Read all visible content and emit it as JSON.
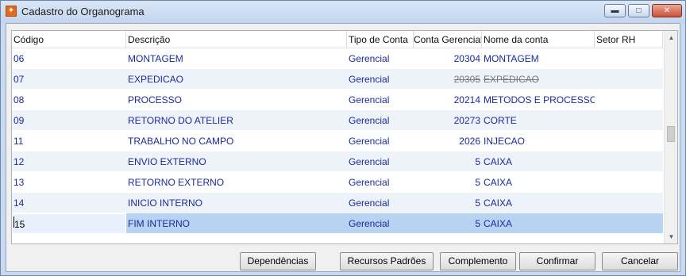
{
  "window": {
    "title": "Cadastro do Organograma",
    "controls": {
      "minimize": "▬",
      "maximize": "□",
      "close": "✕"
    }
  },
  "grid": {
    "columns": [
      "Código",
      "Descrição",
      "Tipo de Conta",
      "Conta Gerencial",
      "Nome da conta",
      "Setor RH"
    ],
    "rows": [
      {
        "codigo": "06",
        "descricao": "MONTAGEM",
        "tipo": "Gerencial",
        "conta": "20304",
        "nome": "MONTAGEM",
        "setor": ""
      },
      {
        "codigo": "07",
        "descricao": "EXPEDICAO",
        "tipo": "Gerencial",
        "conta": "20305",
        "nome": "EXPEDICAO",
        "setor": ""
      },
      {
        "codigo": "08",
        "descricao": "PROCESSO",
        "tipo": "Gerencial",
        "conta": "20214",
        "nome": "METODOS E PROCESSOS",
        "setor": ""
      },
      {
        "codigo": "09",
        "descricao": "RETORNO DO ATELIER",
        "tipo": "Gerencial",
        "conta": "20273",
        "nome": "CORTE",
        "setor": ""
      },
      {
        "codigo": "11",
        "descricao": "TRABALHO NO CAMPO",
        "tipo": "Gerencial",
        "conta": "2026",
        "nome": "INJECAO",
        "setor": ""
      },
      {
        "codigo": "12",
        "descricao": "ENVIO EXTERNO",
        "tipo": "Gerencial",
        "conta": "5",
        "nome": "CAIXA",
        "setor": ""
      },
      {
        "codigo": "13",
        "descricao": "RETORNO EXTERNO",
        "tipo": "Gerencial",
        "conta": "5",
        "nome": "CAIXA",
        "setor": ""
      },
      {
        "codigo": "14",
        "descricao": "INICIO INTERNO",
        "tipo": "Gerencial",
        "conta": "5",
        "nome": "CAIXA",
        "setor": ""
      },
      {
        "codigo": "15",
        "descricao": "FIM INTERNO",
        "tipo": "Gerencial",
        "conta": "5",
        "nome": "CAIXA",
        "setor": ""
      }
    ],
    "strikethrough_row_index": 1,
    "selected_row_index": 8
  },
  "buttons": {
    "dependencias": "Dependências",
    "recursos": "Recursos Padrões",
    "complemento": "Complemento",
    "confirmar": "Confirmar",
    "cancelar": "Cancelar"
  },
  "colors": {
    "text_blue": "#1c2a9c",
    "selected_row": "#b6d4f2",
    "alt_row": "#eef3f9"
  }
}
